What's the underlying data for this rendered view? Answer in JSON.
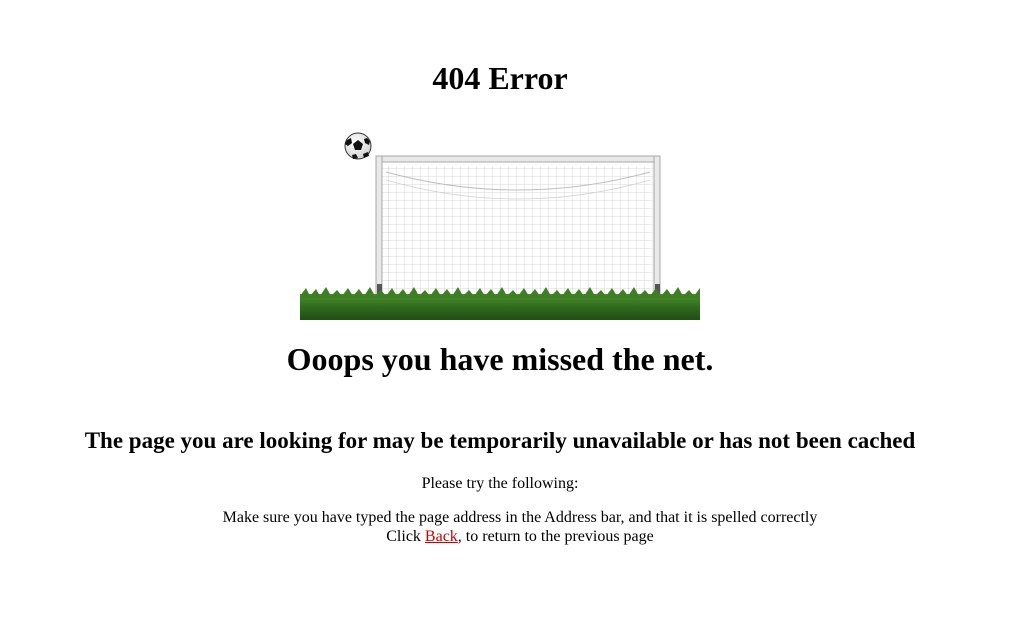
{
  "page": {
    "title": "404 Error",
    "headline": "Ooops you have missed the net.",
    "subheadline": "The page you are looking for may be temporarily unavailable or has not been cached",
    "try_text": "Please try the following:",
    "suggestion_1": "Make sure you have typed the page address in the Address bar, and that it is spelled correctly",
    "suggestion_2_prefix": "Click ",
    "suggestion_2_link": "Back",
    "suggestion_2_suffix": ", to return to the previous page"
  },
  "illustration": {
    "name": "soccer-goal-illustration",
    "icons": [
      "soccer-ball-icon",
      "goal-net-icon",
      "grass-icon"
    ]
  },
  "colors": {
    "link": "#cc0000",
    "grass": "#2f6b1e",
    "text": "#000000"
  }
}
